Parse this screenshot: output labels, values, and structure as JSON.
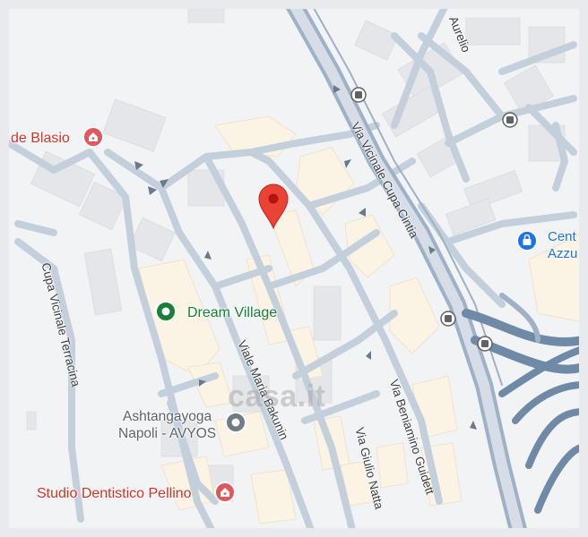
{
  "map": {
    "pois": {
      "de_blasio": "de Blasio",
      "dream_village": "Dream Village",
      "ashtanga_line1": "Ashtangayoga",
      "ashtanga_line2": "Napoli - AVYOS",
      "studio_dentistico": "Studio Dentistico Pellino",
      "centro_line1": "Cent",
      "centro_line2": "Azzu"
    },
    "roads": {
      "via_aurelio": "Aurelio",
      "via_vicinale_cupa_cintia": "Via Vicinale Cupa Cintia",
      "cupa_vicinale_terracina": "Cupa Vicinale Terracina",
      "viale_maria_bakunin": "Viale Maria Bakunin",
      "via_beniamino_guidetti": "Via Beniamino Guidett",
      "via_giulio_natta": "Via Giulio Natta"
    },
    "watermark": "casa.it",
    "colors": {
      "background": "#f1f3f4",
      "road": "#c3cfdb",
      "highway": "#9eb1c6",
      "building": "#e4e6e9",
      "building_highlight": "#fbf3e4",
      "pin": "#ea4335",
      "poi_medical": "#e0585b",
      "poi_green": "#188038",
      "poi_blue": "#1a73e8"
    },
    "icons": [
      "map-pin-icon",
      "hospital-icon",
      "park-icon",
      "gym-icon",
      "bag-icon",
      "bus-stop-icon"
    ]
  }
}
